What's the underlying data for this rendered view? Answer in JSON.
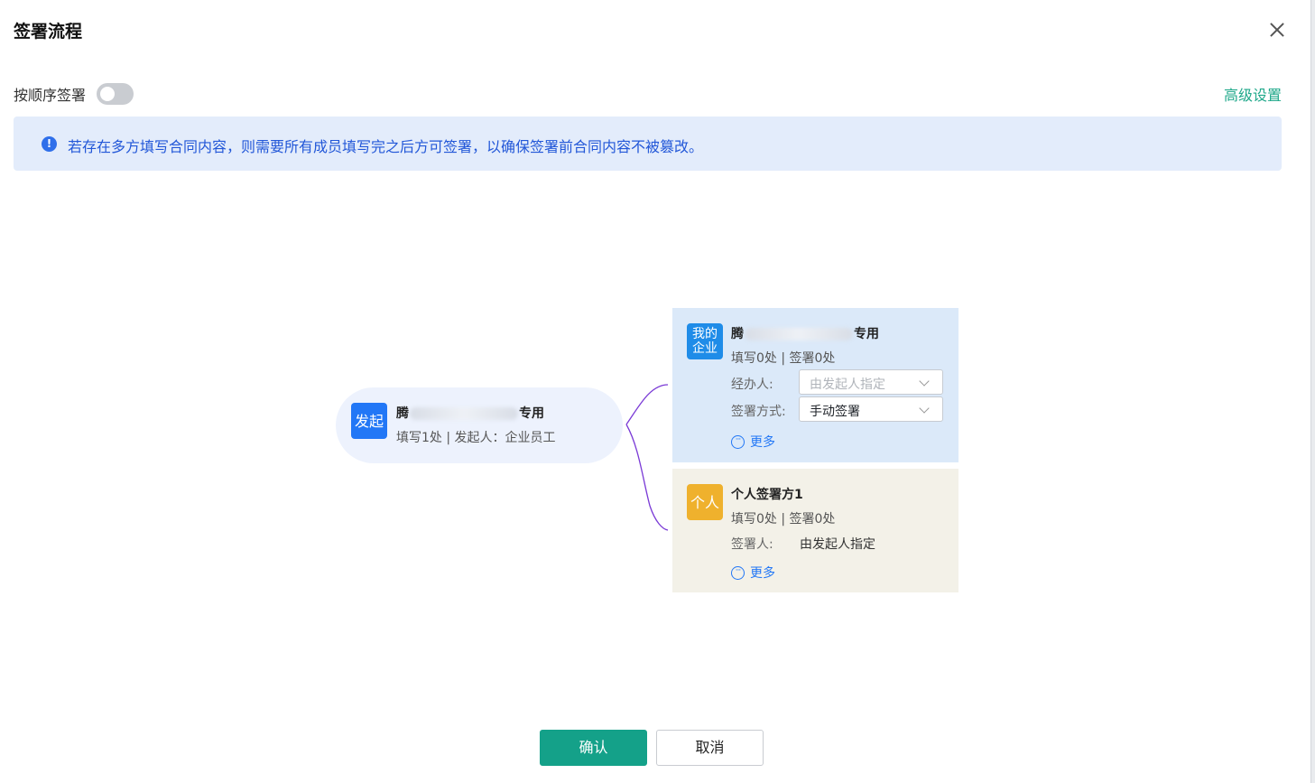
{
  "dialog": {
    "title": "签署流程"
  },
  "settings": {
    "sequential_label": "按顺序签署",
    "sequential_enabled": false,
    "advanced_label": "高级设置"
  },
  "notice": {
    "text": "若存在多方填写合同内容，则需要所有成员填写完之后方可签署，以确保签署前合同内容不被篡改。"
  },
  "origin": {
    "badge": "发起",
    "name_prefix": "腾",
    "name_suffix": "专用",
    "summary": "填写1处 | 发起人：企业员工"
  },
  "company_signer": {
    "badge": "我的企业",
    "name_prefix": "腾",
    "name_suffix": "专用",
    "summary": "填写0处 | 签署0处",
    "operator_label": "经办人:",
    "operator_placeholder": "由发起人指定",
    "method_label": "签署方式:",
    "method_value": "手动签署",
    "more_label": "更多"
  },
  "personal_signer": {
    "badge": "个人",
    "name": "个人签署方1",
    "summary": "填写0处 | 签署0处",
    "signer_label": "签署人:",
    "signer_value": "由发起人指定",
    "more_label": "更多"
  },
  "footer": {
    "confirm_label": "确认",
    "cancel_label": "取消"
  },
  "colors": {
    "accent_green": "#14a189",
    "link_green": "#1fa88a",
    "primary_blue": "#2277f6",
    "notice_bg": "#e3ecfb",
    "company_card_bg": "#dbe9f9",
    "personal_card_bg": "#f3f1e8",
    "personal_badge": "#efb12d",
    "connector": "#7a3ad6"
  }
}
